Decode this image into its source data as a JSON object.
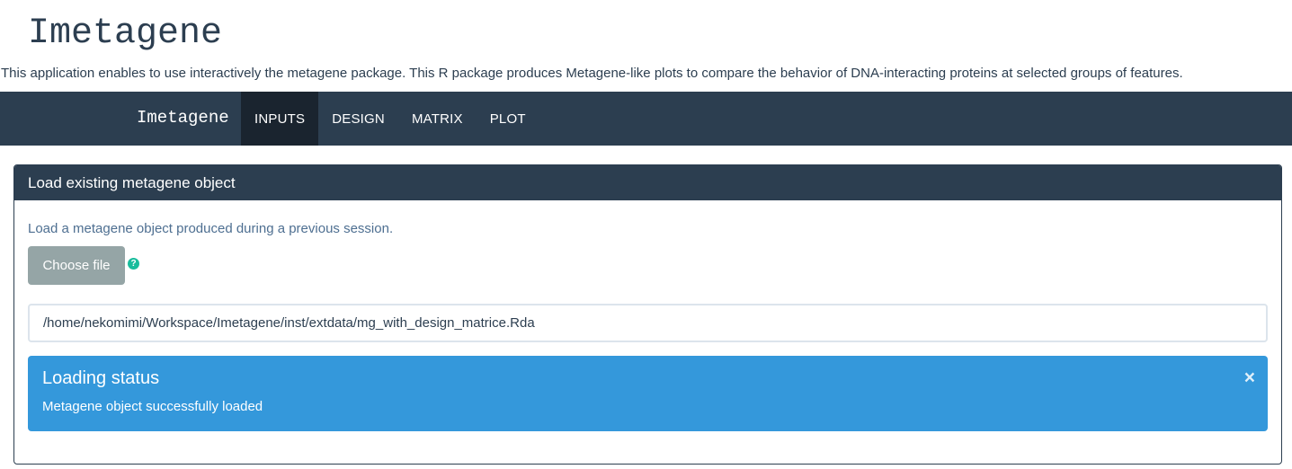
{
  "header": {
    "title": "Imetagene",
    "description": "This application enables to use interactively the metagene package. This R package produces Metagene-like plots to compare the behavior of DNA-interacting proteins at selected groups of features."
  },
  "navbar": {
    "brand": "Imetagene",
    "tabs": [
      {
        "label": "INPUTS",
        "active": true
      },
      {
        "label": "DESIGN",
        "active": false
      },
      {
        "label": "MATRIX",
        "active": false
      },
      {
        "label": "PLOT",
        "active": false
      }
    ]
  },
  "panel": {
    "heading": "Load existing metagene object",
    "help_text": "Load a metagene object produced during a previous session.",
    "file_button_label": "Choose file",
    "help_icon": "question-circle-icon",
    "file_path": "/home/nekomimi/Workspace/Imetagene/inst/extdata/mg_with_design_matrice.Rda",
    "alert": {
      "title": "Loading status",
      "message": "Metagene object successfully loaded",
      "close_symbol": "×"
    }
  },
  "colors": {
    "primary": "#2c3e50",
    "primary_dark": "#1a242f",
    "info": "#3498db",
    "success": "#18bc9c",
    "muted_button": "#95a5a6"
  }
}
